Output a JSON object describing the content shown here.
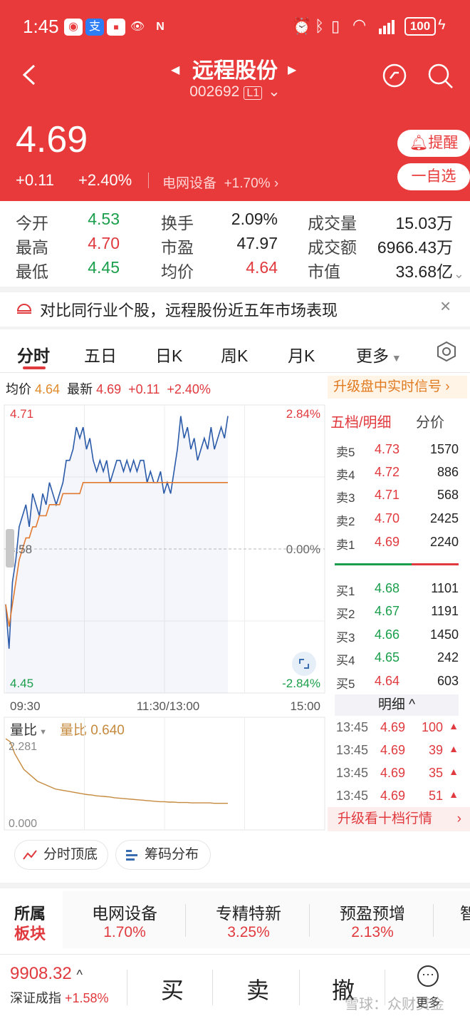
{
  "status": {
    "time": "1:45",
    "battery": "100"
  },
  "header": {
    "title": "远程股份",
    "code": "002692",
    "level": "L1",
    "price": "4.69",
    "change": "+0.11",
    "change_pct": "+2.40%",
    "sector_name": "电网设备",
    "sector_pct": "+1.70%",
    "remind": "提醒",
    "watchlist": "一自选"
  },
  "stats": [
    {
      "label": "今开",
      "value": "4.53",
      "color": "green"
    },
    {
      "label": "换手",
      "value": "2.09%",
      "color": "dark"
    },
    {
      "label": "成交量",
      "value": "15.03万",
      "color": "dark"
    },
    {
      "label": "最高",
      "value": "4.70",
      "color": "red"
    },
    {
      "label": "市盈",
      "value": "47.97",
      "color": "dark"
    },
    {
      "label": "成交额",
      "value": "6966.43万",
      "color": "dark"
    },
    {
      "label": "最低",
      "value": "4.45",
      "color": "green"
    },
    {
      "label": "均价",
      "value": "4.64",
      "color": "red"
    },
    {
      "label": "市值",
      "value": "33.68亿",
      "color": "dark"
    }
  ],
  "banner": "对比同行业个股，远程股份近五年市场表现",
  "tabs": [
    "分时",
    "五日",
    "日K",
    "周K",
    "月K",
    "更多"
  ],
  "chart_info": {
    "avg_label": "均价",
    "avg_value": "4.64",
    "latest_label": "最新",
    "latest_value": "4.69",
    "change": "+0.11",
    "change_pct": "+2.40%",
    "upgrade": "升级盘中实时信号"
  },
  "chart_data": {
    "type": "line",
    "y_top": "4.71",
    "y_mid": "4.58",
    "y_bottom": "4.45",
    "pct_top": "2.84%",
    "pct_mid": "0.00%",
    "pct_bottom": "-2.84%",
    "ylim": [
      4.45,
      4.71
    ],
    "x_labels": [
      "09:30",
      "11:30/13:00",
      "15:00"
    ],
    "series": [
      {
        "values": [
          4.53,
          4.49,
          4.55,
          4.57,
          4.6,
          4.61,
          4.62,
          4.6,
          4.63,
          4.62,
          4.61,
          4.63,
          4.62,
          4.64,
          4.63,
          4.62,
          4.63,
          4.64,
          4.66,
          4.66,
          4.67,
          4.69,
          4.68,
          4.69,
          4.67,
          4.68,
          4.66,
          4.65,
          4.66,
          4.65,
          4.66,
          4.64,
          4.65,
          4.66,
          4.66,
          4.65,
          4.66,
          4.65,
          4.66,
          4.65,
          4.66,
          4.66,
          4.64,
          4.65,
          4.64,
          4.64,
          4.65,
          4.63,
          4.64,
          4.63,
          4.65,
          4.67,
          4.7,
          4.68,
          4.69,
          4.67,
          4.68,
          4.66,
          4.67,
          4.68,
          4.67,
          4.69,
          4.67,
          4.68,
          4.69,
          4.68,
          4.7
        ]
      },
      {
        "values": [
          4.53,
          4.51,
          4.53,
          4.55,
          4.57,
          4.58,
          4.59,
          4.59,
          4.6,
          4.6,
          4.61,
          4.61,
          4.61,
          4.62,
          4.62,
          4.62,
          4.62,
          4.63,
          4.63,
          4.63,
          4.63,
          4.63,
          4.63,
          4.64,
          4.64,
          4.64,
          4.64,
          4.64,
          4.64,
          4.64,
          4.64,
          4.64,
          4.64,
          4.64,
          4.64,
          4.64,
          4.64,
          4.64,
          4.64,
          4.64,
          4.64,
          4.64,
          4.64,
          4.64,
          4.64,
          4.64,
          4.64,
          4.64,
          4.64,
          4.64,
          4.64,
          4.64,
          4.64,
          4.64,
          4.64,
          4.64,
          4.64,
          4.64,
          4.64,
          4.64,
          4.64,
          4.64,
          4.64,
          4.64,
          4.64,
          4.64,
          4.64
        ]
      }
    ],
    "vol_ratio": {
      "label": "量比",
      "value_label": "量比 0.640",
      "top": "2.281",
      "bottom": "0.000",
      "ylim": [
        0,
        2.281
      ],
      "values": [
        2.28,
        2.2,
        1.9,
        1.7,
        1.5,
        1.4,
        1.3,
        1.2,
        1.15,
        1.1,
        1.05,
        1.0,
        0.98,
        0.96,
        0.94,
        0.92,
        0.9,
        0.88,
        0.86,
        0.85,
        0.83,
        0.82,
        0.81,
        0.8,
        0.78,
        0.77,
        0.76,
        0.75,
        0.74,
        0.73,
        0.72,
        0.71,
        0.7,
        0.69,
        0.68,
        0.68,
        0.67,
        0.67,
        0.66,
        0.66,
        0.66,
        0.65,
        0.65,
        0.65,
        0.65,
        0.65,
        0.64,
        0.64,
        0.64,
        0.64
      ]
    }
  },
  "orderbook": {
    "header_a": "五档/明细",
    "header_b": "分价",
    "sells": [
      {
        "label": "卖5",
        "price": "4.73",
        "vol": "1570"
      },
      {
        "label": "卖4",
        "price": "4.72",
        "vol": "886"
      },
      {
        "label": "卖3",
        "price": "4.71",
        "vol": "568"
      },
      {
        "label": "卖2",
        "price": "4.70",
        "vol": "2425"
      },
      {
        "label": "卖1",
        "price": "4.69",
        "vol": "2240"
      }
    ],
    "buys": [
      {
        "label": "买1",
        "price": "4.68",
        "vol": "1101"
      },
      {
        "label": "买2",
        "price": "4.67",
        "vol": "1191"
      },
      {
        "label": "买3",
        "price": "4.66",
        "vol": "1450"
      },
      {
        "label": "买4",
        "price": "4.65",
        "vol": "242"
      },
      {
        "label": "买5",
        "price": "4.64",
        "vol": "603"
      }
    ],
    "detail_title": "明细",
    "ticks": [
      {
        "time": "13:45",
        "price": "4.69",
        "vol": "100"
      },
      {
        "time": "13:45",
        "price": "4.69",
        "vol": "39"
      },
      {
        "time": "13:45",
        "price": "4.69",
        "vol": "35"
      },
      {
        "time": "13:45",
        "price": "4.69",
        "vol": "51"
      }
    ],
    "upgrade10": "升级看十档行情"
  },
  "tools": [
    "分时顶底",
    "筹码分布"
  ],
  "sectors": {
    "title_a": "所属",
    "title_b": "板块",
    "items": [
      {
        "name": "电网设备",
        "pct": "1.70%"
      },
      {
        "name": "专精特新",
        "pct": "3.25%"
      },
      {
        "name": "预盈预增",
        "pct": "2.13%"
      }
    ],
    "partial": "智"
  },
  "footer": {
    "index_value": "9908.32",
    "index_name": "深证成指",
    "index_pct": "+1.58%",
    "buy": "买",
    "sell": "卖",
    "cancel": "撤",
    "more": "更多",
    "watermark": "雪球：众财资金"
  }
}
